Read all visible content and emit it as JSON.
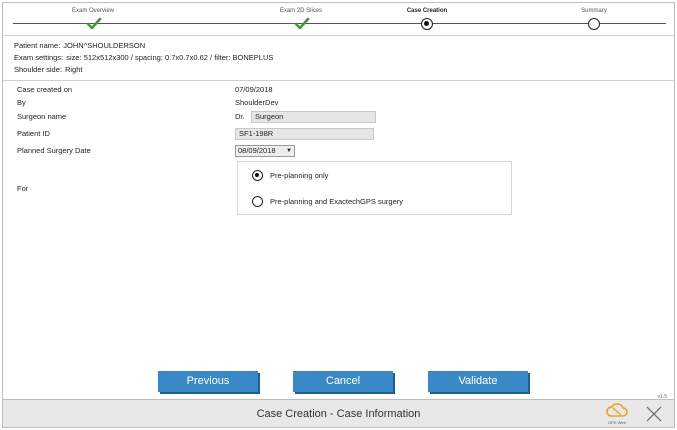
{
  "steps": [
    {
      "label": "Exam Overview",
      "state": "done"
    },
    {
      "label": "Exam 2D Slices",
      "state": "done"
    },
    {
      "label": "Case Creation",
      "state": "current"
    },
    {
      "label": "Summary",
      "state": "pending"
    }
  ],
  "patient": {
    "name_key": "Patient name:",
    "name_val": "JOHN^SHOULDERSON",
    "exam_key": "Exam settings:",
    "exam_val": "size: 512x512x300 / spacing: 0.7x0.7x0.62 / filter: BONEPLUS",
    "side_key": "Shoulder side:",
    "side_val": "Right"
  },
  "form": {
    "created_label": "Case created on",
    "created_value": "07/09/2018",
    "by_label": "By",
    "by_value": "ShoulderDev",
    "surgeon_label": "Surgeon name",
    "surgeon_prefix": "Dr.",
    "surgeon_value": "Surgeon",
    "patient_id_label": "Patient ID",
    "patient_id_value": "SF1-198R",
    "surgery_date_label": "Planned Surgery Date",
    "surgery_date_value": "08/09/2018",
    "for_label": "For",
    "option_1": "Pre-planning only",
    "option_2": "Pre-planning and ExactechGPS surgery",
    "selected_option": 1
  },
  "buttons": {
    "previous": "Previous",
    "cancel": "Cancel",
    "validate": "Validate"
  },
  "version": "v1.5",
  "footer": {
    "title": "Case Creation - Case Information",
    "gps_web_label": "GPS Web"
  },
  "icons": {
    "done": "check-icon",
    "current": "filled-circle-icon",
    "pending": "empty-circle-icon",
    "gps_web": "cloud-icon",
    "close": "close-icon"
  },
  "colors": {
    "accent": "#3a89c6",
    "check": "#3f9a3b",
    "gps_web": "#f0a020"
  }
}
